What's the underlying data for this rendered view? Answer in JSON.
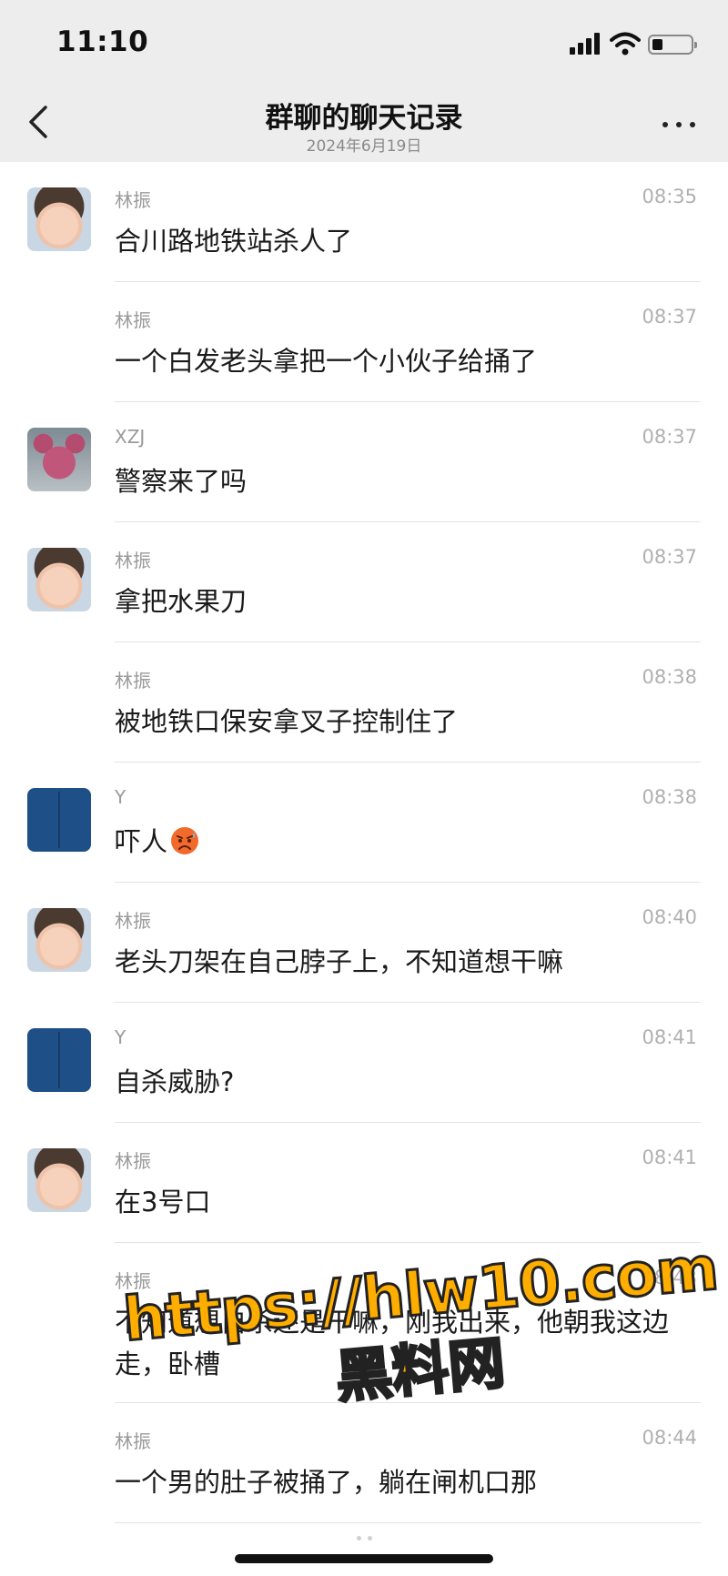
{
  "status_bar": {
    "time": "11:10"
  },
  "nav": {
    "title": "群聊的聊天记录",
    "subtitle": "2024年6月19日"
  },
  "messages": [
    {
      "sender": "林振",
      "time": "08:35",
      "text": "合川路地铁站杀人了",
      "avatar": "baby-photo"
    },
    {
      "sender": "林振",
      "time": "08:37",
      "text": "一个白发老头拿把一个小伙子给捅了",
      "avatar": ""
    },
    {
      "sender": "XZJ",
      "time": "08:37",
      "text": "警察来了吗",
      "avatar": "pink-bear"
    },
    {
      "sender": "林振",
      "time": "08:37",
      "text": "拿把水果刀",
      "avatar": "baby-photo"
    },
    {
      "sender": "林振",
      "time": "08:38",
      "text": "被地铁口保安拿叉子控制住了",
      "avatar": ""
    },
    {
      "sender": "Y",
      "time": "08:38",
      "text": "吓人",
      "avatar": "blue-square",
      "emoji": "scared-face-emoji"
    },
    {
      "sender": "林振",
      "time": "08:40",
      "text": "老头刀架在自己脖子上，不知道想干嘛",
      "avatar": "baby-photo"
    },
    {
      "sender": "Y",
      "time": "08:41",
      "text": "自杀威胁?",
      "avatar": "blue-square"
    },
    {
      "sender": "林振",
      "time": "08:41",
      "text": "在3号口",
      "avatar": "baby-photo"
    },
    {
      "sender": "林振",
      "time": "08:43",
      "text": "不知道想自杀还是干嘛，刚我出来，他朝我这边走，卧槽",
      "avatar": ""
    },
    {
      "sender": "林振",
      "time": "08:44",
      "text": "一个男的肚子被捅了，躺在闸机口那",
      "avatar": ""
    }
  ],
  "watermark": {
    "line1": "https://hlw10.com",
    "line2": "黑料网"
  },
  "colors": {
    "header_bg": "#ededed",
    "watermark": "#ffae00",
    "avatar_blue": "#1e4f86"
  }
}
